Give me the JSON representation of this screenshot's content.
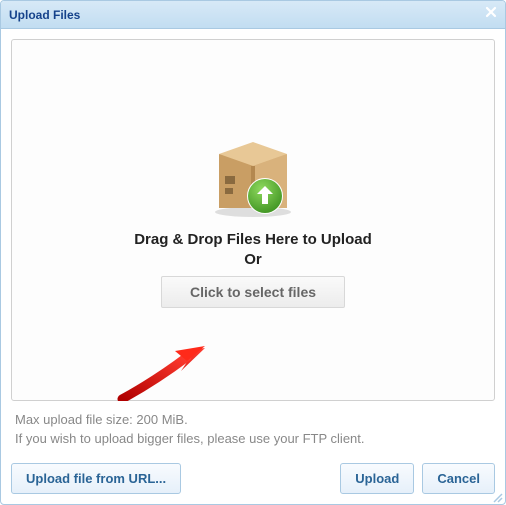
{
  "dialog": {
    "title": "Upload Files"
  },
  "dropzone": {
    "drag_text_line1": "Drag & Drop Files Here to Upload",
    "drag_text_line2": "Or",
    "select_button_label": "Click to select files"
  },
  "info": {
    "max_size": "Max upload file size: 200 MiB.",
    "ftp_hint": "If you wish to upload bigger files, please use your FTP client."
  },
  "footer": {
    "upload_from_url_label": "Upload file from URL...",
    "upload_label": "Upload",
    "cancel_label": "Cancel"
  },
  "icons": {
    "close": "close-icon",
    "box": "package-upload-icon",
    "resize": "resize-handle-icon"
  }
}
